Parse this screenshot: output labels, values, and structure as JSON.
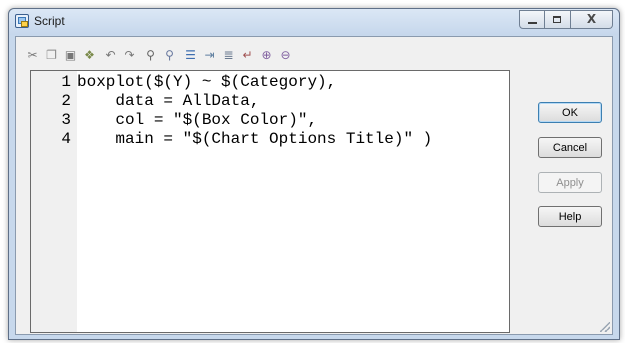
{
  "window": {
    "title": "Script"
  },
  "window_controls": {
    "minimize": "minimize",
    "maximize": "maximize",
    "close": "X"
  },
  "toolbar": {
    "icons": [
      {
        "name": "cut-icon",
        "glyph": "✂",
        "color": "#7a7a7a"
      },
      {
        "name": "copy-icon",
        "glyph": "❐",
        "color": "#8a8a8a"
      },
      {
        "name": "paste-icon",
        "glyph": "▣",
        "color": "#777777"
      },
      {
        "name": "format-icon",
        "glyph": "❖",
        "color": "#7a8a4a"
      },
      {
        "name": "undo-icon",
        "glyph": "↶",
        "color": "#777777"
      },
      {
        "name": "redo-icon",
        "glyph": "↷",
        "color": "#777777"
      },
      {
        "name": "find-icon",
        "glyph": "⚲",
        "color": "#666666"
      },
      {
        "name": "replace-icon",
        "glyph": "⚲",
        "color": "#6a7aa0"
      },
      {
        "name": "line-numbers-icon",
        "glyph": "☰",
        "color": "#3f6fb0"
      },
      {
        "name": "indent-icon",
        "glyph": "⇥",
        "color": "#5f7fa0"
      },
      {
        "name": "outdent-icon",
        "glyph": "≣",
        "color": "#6a7a90"
      },
      {
        "name": "word-wrap-icon",
        "glyph": "↵",
        "color": "#a05050"
      },
      {
        "name": "zoom-in-icon",
        "glyph": "⊕",
        "color": "#8060a0"
      },
      {
        "name": "zoom-out-icon",
        "glyph": "⊖",
        "color": "#8060a0"
      }
    ]
  },
  "editor": {
    "lines": [
      {
        "number": "1",
        "code": "boxplot($(Y) ~ $(Category),"
      },
      {
        "number": "2",
        "code": "    data = AllData,"
      },
      {
        "number": "3",
        "code": "    col = \"$(Box Color)\","
      },
      {
        "number": "4",
        "code": "    main = \"$(Chart Options Title)\" )"
      }
    ]
  },
  "buttons": {
    "ok": "OK",
    "cancel": "Cancel",
    "apply": "Apply",
    "help": "Help"
  },
  "colors": {
    "accent": "#3c7fb1",
    "window_frame": "#c7d8ec",
    "disabled_text": "#8f8f8f"
  }
}
